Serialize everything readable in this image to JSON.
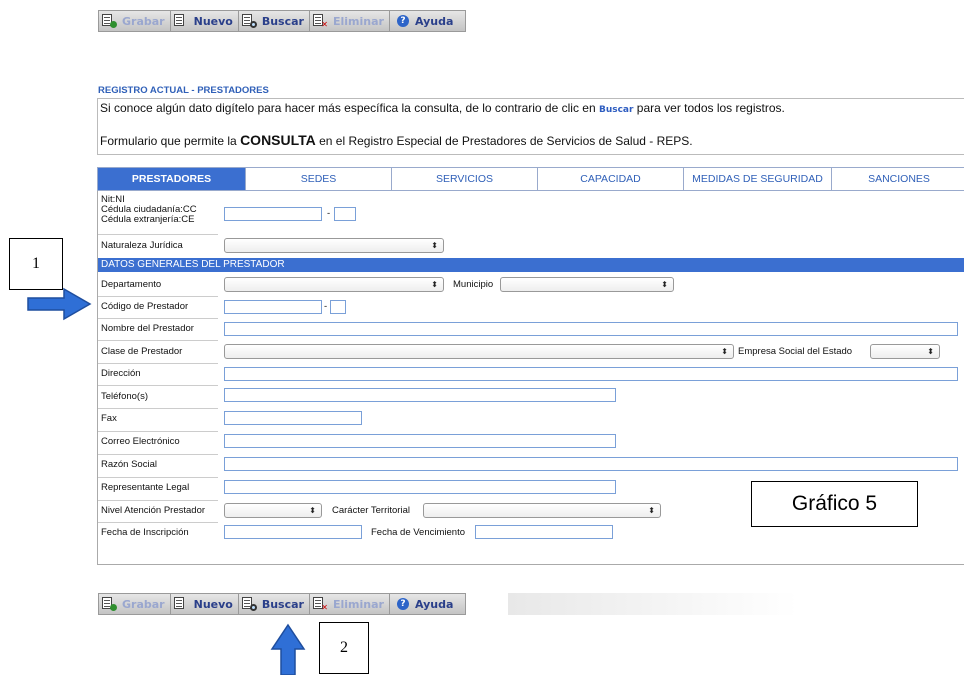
{
  "toolbar": {
    "grabar": "Grabar",
    "nuevo": "Nuevo",
    "buscar": "Buscar",
    "eliminar": "Eliminar",
    "ayuda": "Ayuda"
  },
  "header": {
    "section_title": "REGISTRO ACTUAL - PRESTADORES",
    "info_line1_before": "Si conoce algún dato digítelo para hacer más específica la consulta, de lo contrario de clic en ",
    "info_line1_link": "Buscar",
    "info_line1_after": " para ver todos los registros.",
    "info_line2_before": "Formulario que permite la ",
    "info_line2_bold": "CONSULTA",
    "info_line2_after": " en el Registro Especial de Prestadores de Servicios de Salud - REPS."
  },
  "tabs": [
    "PRESTADORES",
    "SEDES",
    "SERVICIOS",
    "CAPACIDAD",
    "MEDIDAS DE SEGURIDAD",
    "SANCIONES"
  ],
  "form": {
    "nit_label_1": "Nit:NI",
    "nit_label_2": "Cédula ciudadanía:CC",
    "nit_label_3": "Cédula extranjería:CE",
    "naturaleza": "Naturaleza Jurídica",
    "datos_generales": "DATOS GENERALES DEL PRESTADOR",
    "departamento": "Departamento",
    "municipio": "Municipio",
    "codigo": "Código de Prestador",
    "nombre": "Nombre del Prestador",
    "clase": "Clase de Prestador",
    "empresa_social": "Empresa Social del Estado",
    "direccion": "Dirección",
    "telefono": "Teléfono(s)",
    "fax": "Fax",
    "correo": "Correo Electrónico",
    "razon": "Razón Social",
    "representante": "Representante Legal",
    "nivel": "Nivel Atención Prestador",
    "caracter": "Carácter Territorial",
    "fecha_inscripcion": "Fecha de Inscripción",
    "fecha_vencimiento": "Fecha de Vencimiento",
    "dash": "-"
  },
  "annotations": {
    "label_1": "1",
    "label_2": "2",
    "grafico": "Gráfico 5",
    "arrow_color": "#2f6fd6"
  }
}
